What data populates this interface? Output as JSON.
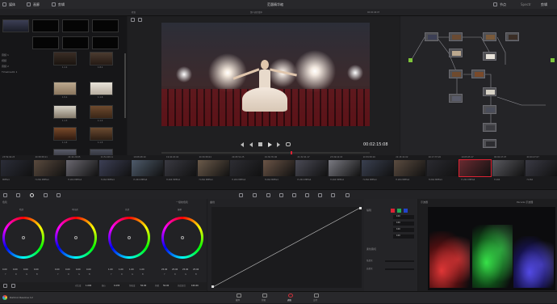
{
  "top_bar": {
    "title": "范惠精华缩",
    "left_items": [
      "媒体",
      "画廊",
      "剪辑"
    ],
    "right_items": [
      "节点",
      "Spectr",
      "剪辑"
    ]
  },
  "viewer": {
    "tab_left": "检查",
    "clip_name": "第1 调示纹中",
    "zoom": "00:00:46:07",
    "timecode": "00:02:15:08"
  },
  "media_pool": {
    "folders": [
      "音频 1",
      "视频",
      "音频 2",
      "Timeline01 1"
    ],
    "thumb_labels": [
      "1.1.1",
      "1.8.1",
      "1.5.1",
      "1.1.6",
      "1.1.3",
      "1.1.2",
      "1.1.4",
      "1.1.5",
      "1.9.1",
      "1.9.7"
    ]
  },
  "clips": [
    {
      "tc": "23:59:49:23",
      "codec": "MPEG4"
    },
    {
      "tc": "20:58:58:11",
      "codec": "H.264 MPEG4"
    },
    {
      "tc": "22:42:20:05",
      "codec": "H.264 MPEG4"
    },
    {
      "tc": "21:51:48:11",
      "codec": "H.264 MPEG4"
    },
    {
      "tc": "19:08:48:10",
      "codec": "H.264 MPEG4"
    },
    {
      "tc": "19:40:20:04",
      "codec": "H.264 MPEG4"
    },
    {
      "tc": "20:30:58:04",
      "codec": "H.264 MPEG4"
    },
    {
      "tc": "20:05:51:25",
      "codec": "H.264 MPEG4"
    },
    {
      "tc": "19:30:35:06",
      "codec": "H.264 MPEG4"
    },
    {
      "tc": "21:32:21:17",
      "codec": "H.264 MPEG4"
    },
    {
      "tc": "23:49:16:15",
      "codec": "H.264 MPEG4"
    },
    {
      "tc": "10:59:58:16",
      "codec": "H.264 MPEG4"
    },
    {
      "tc": "21:15:41:02",
      "codec": "H.264 MPEG4"
    },
    {
      "tc": "20:17:37:20",
      "codec": "H.264 MPEG4"
    },
    {
      "tc": "19:05:05:17",
      "codec": "H.264 MPEG4"
    },
    {
      "tc": "00:00:47:07",
      "codec": "H.264"
    },
    {
      "tc": "00:00:47:07",
      "codec": "H.264"
    }
  ],
  "color_wheels": {
    "panel_title": "色轮",
    "mode": "一级校色轮",
    "wheels": [
      {
        "label": "暗部",
        "values": [
          "0.00",
          "0.00",
          "0.00",
          "0.00"
        ]
      },
      {
        "label": "中间调",
        "values": [
          "0.00",
          "0.00",
          "0.00",
          "0.00"
        ]
      },
      {
        "label": "亮部",
        "values": [
          "1.00",
          "1.00",
          "1.00",
          "1.00"
        ]
      },
      {
        "label": "偏移",
        "values": [
          "25.00",
          "25.00",
          "25.00",
          "25.00"
        ]
      }
    ],
    "channel_labels": [
      "Y",
      "R",
      "G",
      "B"
    ],
    "footer": [
      {
        "label": "对比度",
        "value": "1.000"
      },
      {
        "label": "轴心",
        "value": "0.435"
      },
      {
        "label": "饱和度",
        "value": "50.00"
      },
      {
        "label": "色相",
        "value": "50.00"
      },
      {
        "label": "亮度混合",
        "value": "100.00"
      }
    ]
  },
  "curves": {
    "title": "曲线",
    "edit_label": "编辑",
    "values": [
      "100",
      "100",
      "100",
      "100"
    ],
    "soft_clip_label": "柔化裁切",
    "low_label": "低柔化",
    "high_label": "高柔化"
  },
  "scopes": {
    "title": "示波器",
    "mode": "Parade 示波器"
  },
  "pages": [
    "媒体",
    "剪辑",
    "调色",
    "交付"
  ],
  "active_page_index": 2,
  "footer": {
    "app": "DaVinci Resolve 12"
  },
  "colors": {
    "accent": "#d2303a",
    "bg": "#1b1b1d",
    "node_ok": "#6dbf3b"
  }
}
